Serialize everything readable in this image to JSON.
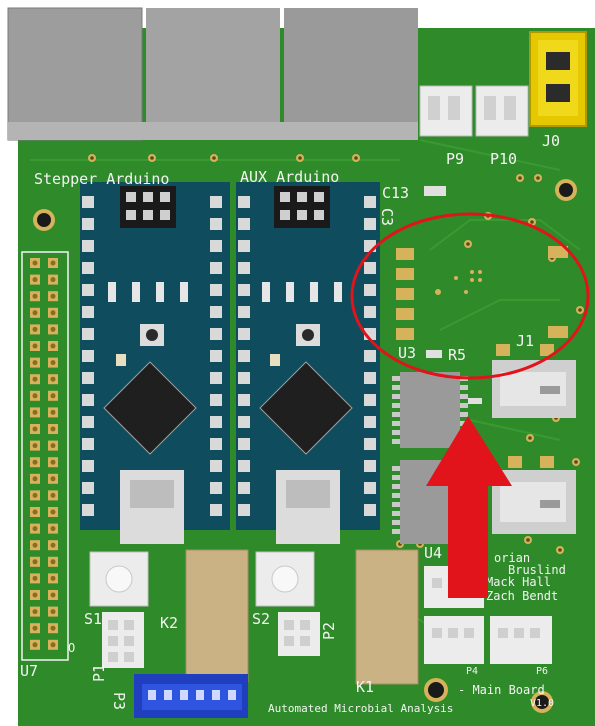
{
  "colors": {
    "pcb": "#2f8a2a",
    "pcb_dark": "#1f6b1f",
    "nano": "#0f4d5e",
    "pin": "#c8b36a",
    "pad": "#d6b25a",
    "silk": "#f4f4f4",
    "annotation": "#e0141a",
    "jumper": "#e6c800"
  },
  "labels": {
    "stepper_arduino": "Stepper Arduino",
    "aux_arduino": "AUX Arduino",
    "c13": "C13",
    "c3": "C3",
    "u3": "U3",
    "r5": "R5",
    "j1": "J1",
    "u4": "U4",
    "u7": "U7",
    "o": "O",
    "s1": "S1",
    "s2": "S2",
    "k2": "K2",
    "k1": "K1",
    "p1": "P1",
    "p2": "P2",
    "p3": "P3",
    "p4": "P4",
    "p6": "P6",
    "p9": "P9",
    "p10": "P10",
    "j0": "J0",
    "credits": [
      "orian",
      "Bruslind",
      "Mack Hall",
      "Zach Bendt"
    ],
    "main_board": "- Main Board",
    "version": "V1.0",
    "footer": "Automated Microbial Analysis"
  }
}
